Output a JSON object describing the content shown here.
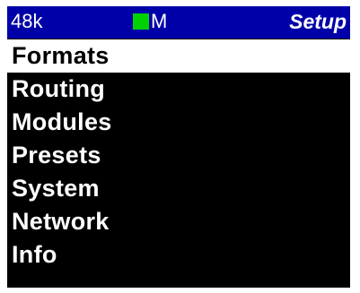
{
  "status_bar": {
    "sample_rate": "48k",
    "lock_indicator_color": "#00d200",
    "mode": "M",
    "title": "Setup"
  },
  "menu": {
    "selected_index": 0,
    "items": [
      {
        "label": "Formats"
      },
      {
        "label": "Routing"
      },
      {
        "label": "Modules"
      },
      {
        "label": "Presets"
      },
      {
        "label": "System"
      },
      {
        "label": "Network"
      },
      {
        "label": "Info"
      }
    ]
  },
  "colors": {
    "status_bar_bg": "#0000a8",
    "screen_bg": "#000000",
    "highlight_bg": "#ffffff"
  }
}
